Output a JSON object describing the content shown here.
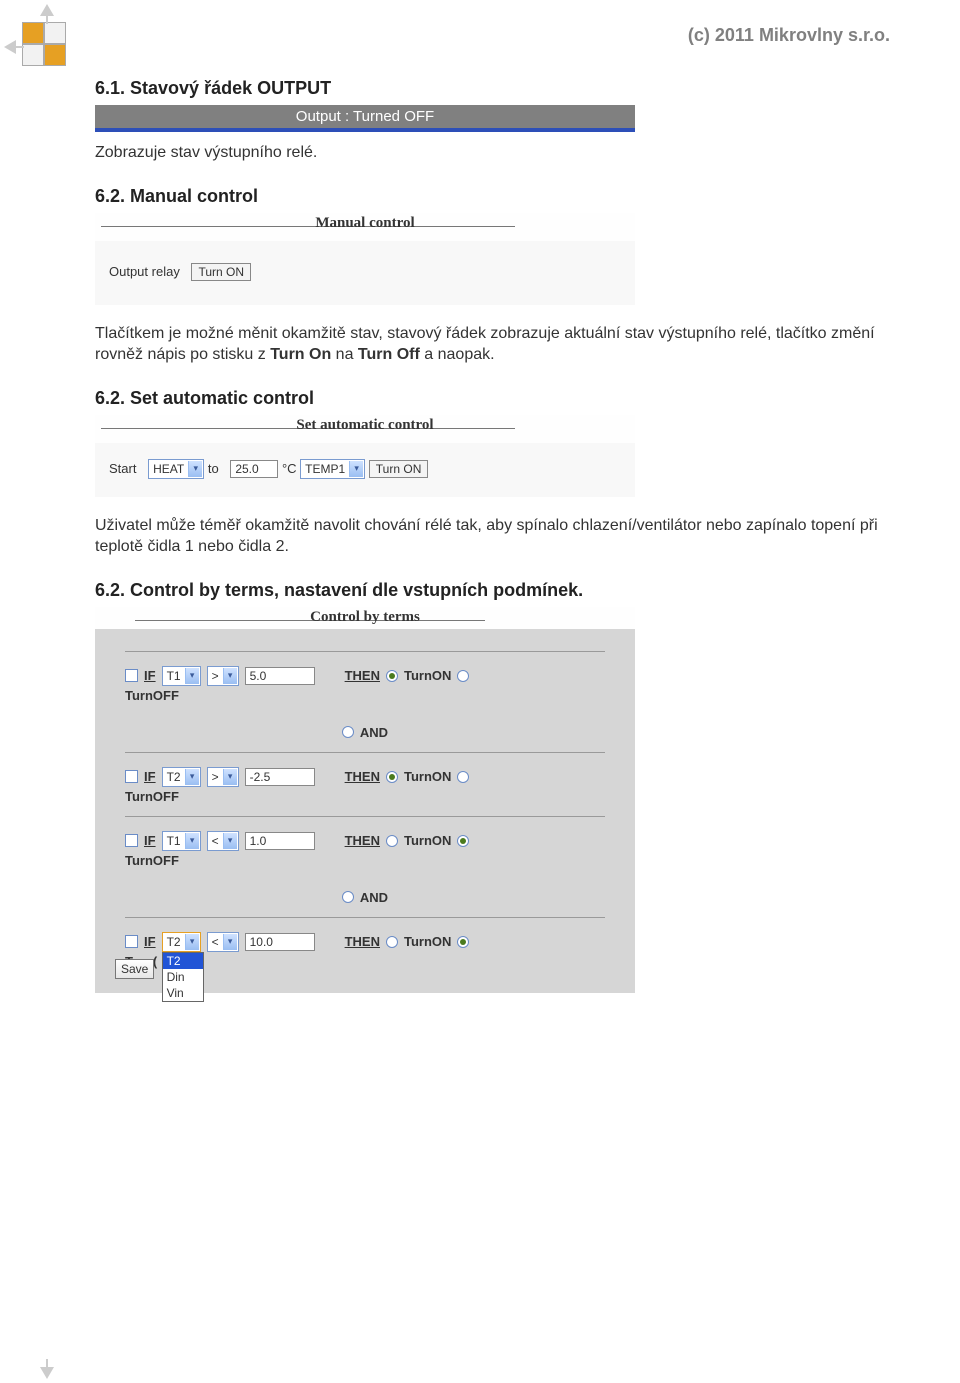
{
  "header": {
    "copyright": "(c) 2011 Mikrovlny s.r.o."
  },
  "sections": {
    "s1": {
      "heading": "6.1. Stavový řádek OUTPUT",
      "caption": "Zobrazuje stav výstupního relé."
    },
    "s2": {
      "heading": "6.2. Manual control",
      "paragraph_pre": "Tlačítkem je možné měnit okamžitě stav, stavový řádek zobrazuje aktuální stav výstupního relé, tlačítko změní rovněž nápis po stisku z ",
      "bold1": "Turn On",
      "mid": " na ",
      "bold2": "Turn Off",
      "paragraph_post": " a naopak."
    },
    "s3": {
      "heading": "6.2. Set automatic control",
      "paragraph": "Uživatel může téměř okamžitě navolit chování rélé tak, aby spínalo chlazení/ventilátor nebo zapínalo topení při teplotě  čidla 1 nebo  čidla 2."
    },
    "s4": {
      "heading": "6.2. Control by terms, nastavení dle vstupních podmínek."
    }
  },
  "ui": {
    "status_bar": {
      "text": "Output : Turned OFF"
    },
    "manual": {
      "title": "Manual control",
      "label": "Output relay",
      "button": "Turn ON"
    },
    "auto": {
      "title": "Set automatic control",
      "start_label": "Start",
      "mode": "HEAT",
      "to_label": "to",
      "value": "25.0",
      "unit": "°C",
      "sensor": "TEMP1",
      "button": "Turn ON"
    },
    "cbt": {
      "title": "Control by terms",
      "if": "IF",
      "then": "THEN",
      "turnon": "TurnON",
      "turnoff": "TurnOFF",
      "and": "AND",
      "save": "Save",
      "rows": [
        {
          "var": "T1",
          "op": ">",
          "val": "5.0",
          "on": true
        },
        {
          "var": "T2",
          "op": ">",
          "val": "-2.5",
          "on": true
        },
        {
          "var": "T1",
          "op": "<",
          "val": "1.0",
          "on": false
        },
        {
          "var": "T2",
          "op": "<",
          "val": "10.0",
          "on": false
        }
      ],
      "dropdown_options": [
        "T2",
        "Din",
        "Vin"
      ]
    }
  }
}
